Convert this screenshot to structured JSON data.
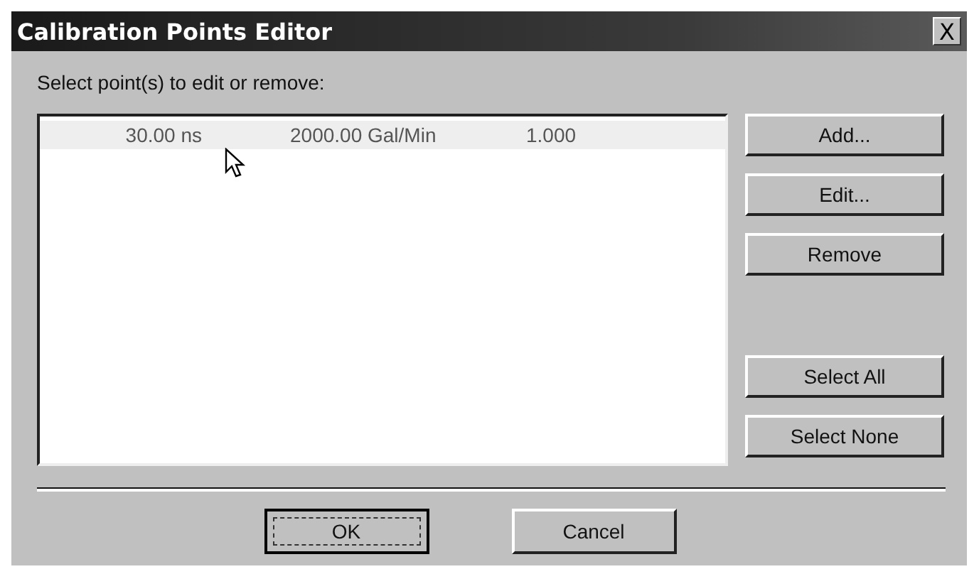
{
  "window": {
    "title": "Calibration Points Editor",
    "close": "X"
  },
  "prompt": "Select point(s) to edit or remove:",
  "points": [
    {
      "time": "30.00 ns",
      "rate": "2000.00 Gal/Min",
      "factor": "1.000",
      "selected": true
    }
  ],
  "side_buttons": [
    "Add...",
    "Edit...",
    "Remove"
  ],
  "selection_buttons": [
    "Select All",
    "Select None"
  ],
  "footer_buttons": [
    {
      "label": "OK",
      "default": true
    },
    {
      "label": "Cancel",
      "default": false
    }
  ]
}
